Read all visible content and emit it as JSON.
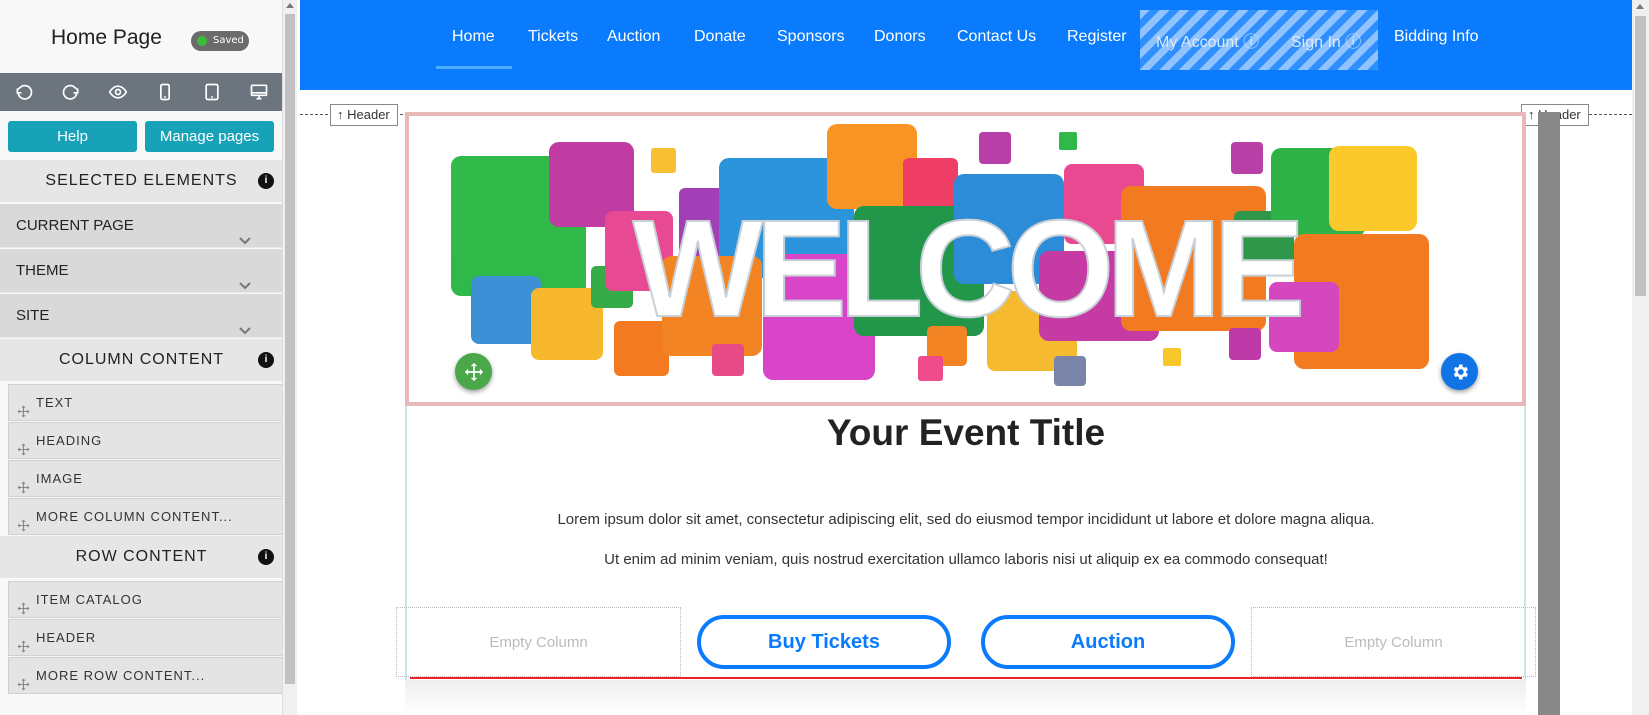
{
  "sidebar": {
    "title": "Home Page",
    "saved_badge": "Saved",
    "toolbar": {
      "icons": [
        "undo-icon",
        "redo-icon",
        "eye-icon",
        "mobile-icon",
        "tablet-icon",
        "desktop-icon"
      ]
    },
    "help_label": "Help",
    "manage_pages_label": "Manage pages",
    "selected_elements": {
      "heading": "SELECTED ELEMENTS",
      "items": [
        "CURRENT PAGE",
        "THEME",
        "SITE"
      ]
    },
    "column_content": {
      "heading": "COLUMN CONTENT",
      "items": [
        "TEXT",
        "HEADING",
        "IMAGE",
        "MORE COLUMN CONTENT..."
      ]
    },
    "row_content": {
      "heading": "ROW CONTENT",
      "items": [
        "ITEM CATALOG",
        "HEADER",
        "MORE ROW CONTENT..."
      ]
    }
  },
  "nav": {
    "items": [
      "Home",
      "Tickets",
      "Auction",
      "Donate",
      "Sponsors",
      "Donors",
      "Contact Us",
      "Register",
      "My Account ⓘ",
      "Sign In ⓘ",
      "Bidding Info"
    ],
    "active": "Home"
  },
  "header_tag": "Header",
  "hero": {
    "text": "WELCOME"
  },
  "main": {
    "title": "Your Event Title",
    "paragraphs": [
      "Lorem ipsum dolor sit amet, consectetur adipiscing elit, sed do eiusmod tempor incididunt ut labore et dolore magna aliqua.",
      "Ut enim ad minim veniam, quis nostrud exercitation ullamco laboris nisi ut aliquip ex ea commodo consequat!"
    ],
    "columns": {
      "empty_label": "Empty Column",
      "buy_tickets": "Buy Tickets",
      "auction": "Auction"
    }
  },
  "colors": {
    "nav_blue": "#0b7bfd",
    "teal_button": "#17a2b8",
    "toolbar_gray": "#6c757d",
    "move_green": "#4aa84b",
    "gear_blue": "#1174e6"
  }
}
